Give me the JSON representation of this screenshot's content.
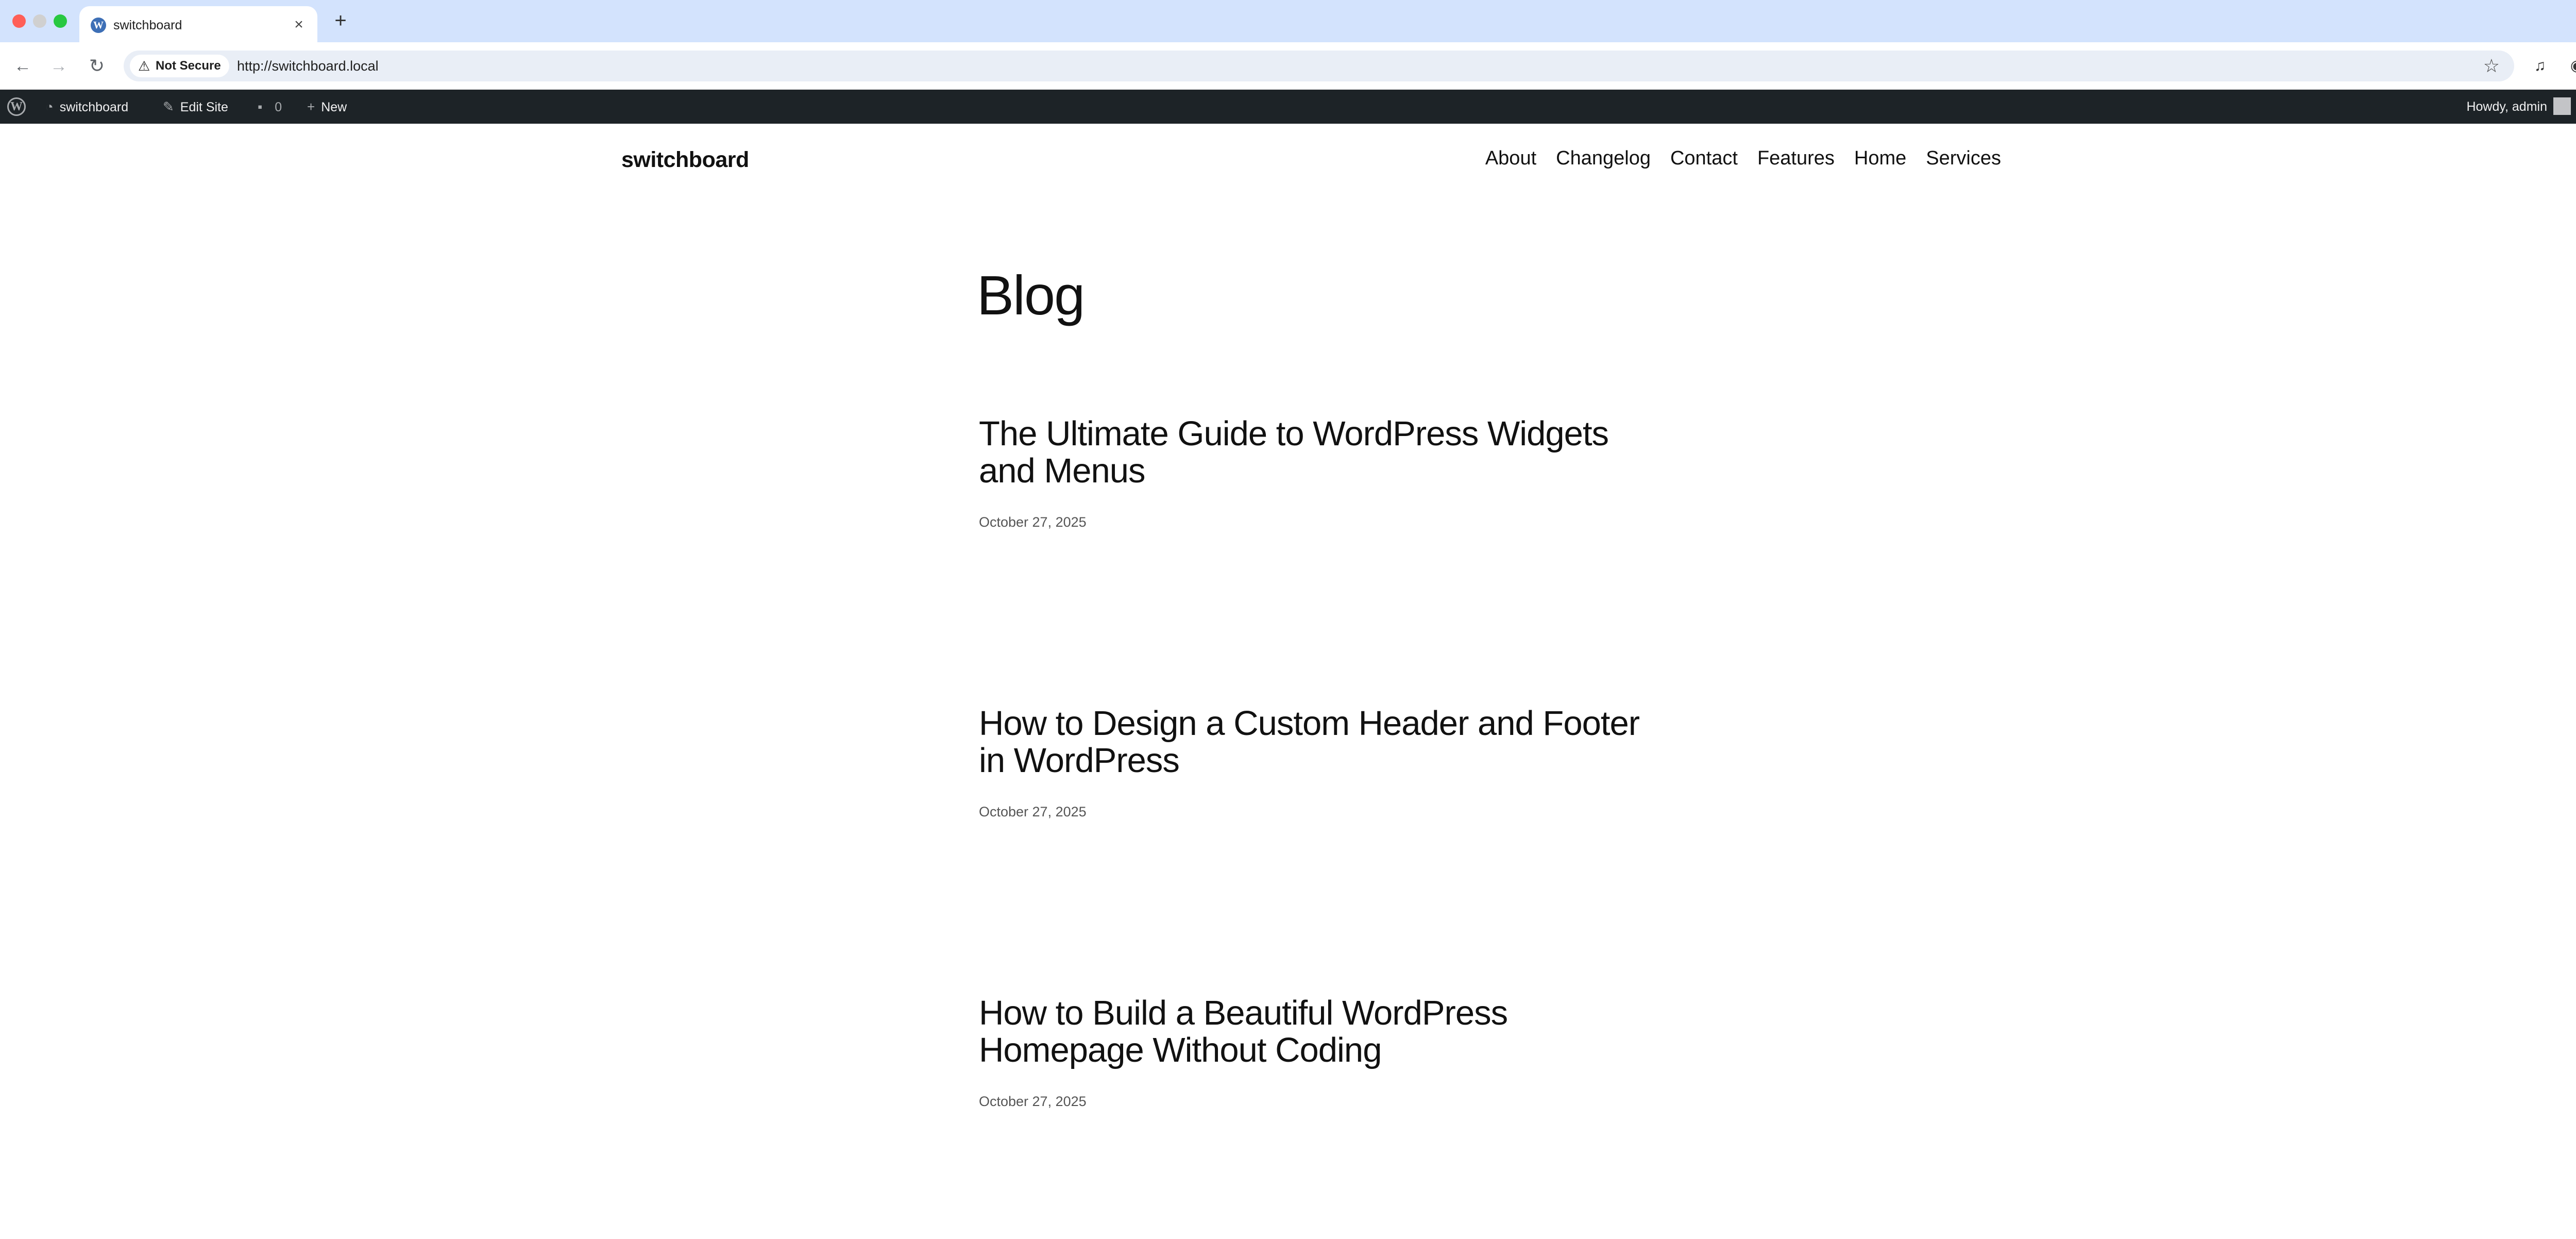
{
  "browser": {
    "tab_title": "switchboard",
    "new_tab_symbol": "+",
    "security_label": "Not Secure",
    "url": "http://switchboard.local",
    "icons": [
      "back-icon",
      "forward-icon",
      "reload-icon",
      "warning-icon",
      "star-icon",
      "media-control-icon",
      "profile-icon",
      "menu-icon",
      "tab-search-icon",
      "close-icon"
    ]
  },
  "adminbar": {
    "site_name": "switchboard",
    "edit_site": "Edit Site",
    "comments_count": "0",
    "new_label": "New",
    "howdy": "Howdy, admin",
    "background": "#1d2327"
  },
  "site": {
    "title": "switchboard",
    "nav": [
      "About",
      "Changelog",
      "Contact",
      "Features",
      "Home",
      "Services"
    ]
  },
  "main": {
    "heading": "Blog",
    "posts": [
      {
        "title": "The Ultimate Guide to WordPress Widgets and Menus",
        "date": "October 27, 2025"
      },
      {
        "title": "How to Design a Custom Header and Footer in WordPress",
        "date": "October 27, 2025"
      },
      {
        "title": "How to Build a Beautiful WordPress Homepage Without Coding",
        "date": "October 27, 2025"
      }
    ]
  }
}
